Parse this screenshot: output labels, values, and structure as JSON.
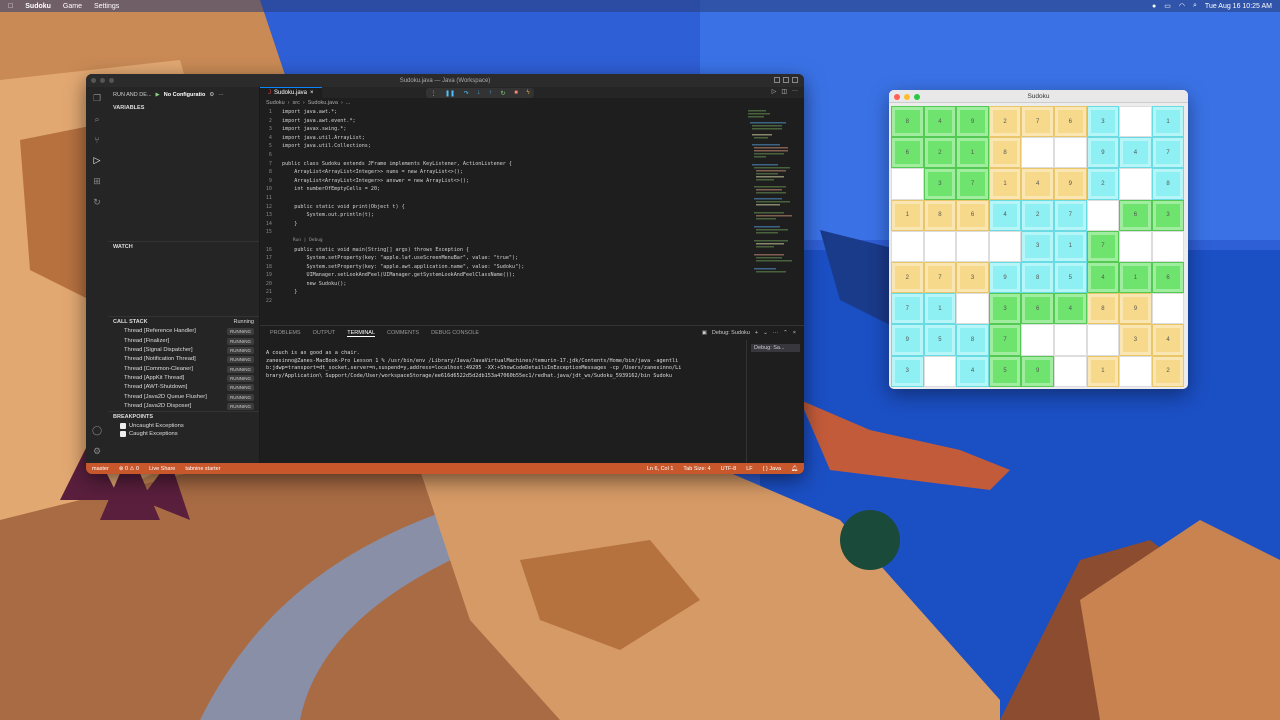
{
  "menubar": {
    "app": "Sudoku",
    "menus": [
      "Game",
      "Settings"
    ],
    "clock": "Tue Aug 16  10:25 AM"
  },
  "vscode": {
    "title": "Sudoku.java — Java (Workspace)",
    "run_label": "RUN AND DE...",
    "config_label": "No Configuratio",
    "sections": {
      "variables": "VARIABLES",
      "watch": "WATCH",
      "call_stack": "CALL STACK",
      "call_stack_status": "Running",
      "breakpoints": "BREAKPOINTS"
    },
    "threads": [
      {
        "name": "Thread [Reference Handler]",
        "status": "RUNNING"
      },
      {
        "name": "Thread [Finalizer]",
        "status": "RUNNING"
      },
      {
        "name": "Thread [Signal Dispatcher]",
        "status": "RUNNING"
      },
      {
        "name": "Thread [Notification Thread]",
        "status": "RUNNING"
      },
      {
        "name": "Thread [Common-Cleaner]",
        "status": "RUNNING"
      },
      {
        "name": "Thread [AppKit Thread]",
        "status": "RUNNING"
      },
      {
        "name": "Thread [AWT-Shutdown]",
        "status": "RUNNING"
      },
      {
        "name": "Thread [Java2D Queue Flusher]",
        "status": "RUNNING"
      },
      {
        "name": "Thread [Java2D Disposer]",
        "status": "RUNNING"
      }
    ],
    "breakpoints": [
      "Uncaught Exceptions",
      "Caught Exceptions"
    ],
    "tab": "Sudoku.java",
    "breadcrumb": [
      "Sudoku",
      "src",
      "Sudoku.java",
      "..."
    ],
    "code": [
      {
        "n": "1",
        "t": "import java.awt.*;"
      },
      {
        "n": "2",
        "t": "import java.awt.event.*;"
      },
      {
        "n": "3",
        "t": "import javax.swing.*;"
      },
      {
        "n": "4",
        "t": "import java.util.ArrayList;"
      },
      {
        "n": "5",
        "t": "import java.util.Collections;"
      },
      {
        "n": "6",
        "t": ""
      },
      {
        "n": "7",
        "t": "public class Sudoku extends JFrame implements KeyListener, ActionListener {"
      },
      {
        "n": "8",
        "t": "    ArrayList<ArrayList<Integer>> nums = new ArrayList<>();"
      },
      {
        "n": "9",
        "t": "    ArrayList<ArrayList<Integer>> answer = new ArrayList<>();"
      },
      {
        "n": "10",
        "t": "    int numberOfEmptyCells = 20;"
      },
      {
        "n": "11",
        "t": ""
      },
      {
        "n": "12",
        "t": "    public static void print(Object t) {"
      },
      {
        "n": "13",
        "t": "        System.out.println(t);"
      },
      {
        "n": "14",
        "t": "    }"
      },
      {
        "n": "15",
        "t": ""
      },
      {
        "n": "",
        "t": "    Run | Debug"
      },
      {
        "n": "16",
        "t": "    public static void main(String[] args) throws Exception {"
      },
      {
        "n": "17",
        "t": "        System.setProperty(key: \"apple.laf.useScreenMenuBar\", value: \"true\");"
      },
      {
        "n": "18",
        "t": "        System.setProperty(key: \"apple.awt.application.name\", value: \"Sudoku\");"
      },
      {
        "n": "19",
        "t": "        UIManager.setLookAndFeel(UIManager.getSystemLookAndFeelClassName());"
      },
      {
        "n": "20",
        "t": "        new Sudoku();"
      },
      {
        "n": "21",
        "t": "    }"
      },
      {
        "n": "22",
        "t": ""
      }
    ],
    "panel_tabs": [
      "PROBLEMS",
      "OUTPUT",
      "TERMINAL",
      "COMMENTS",
      "DEBUG CONSOLE"
    ],
    "panel_active": "TERMINAL",
    "terminal_session": "Debug: Sudoku",
    "terminal_side": "Debug: Sa...",
    "terminal_lines": [
      "A couch is as good as a chair.",
      "zanesinno@Zanes-MacBook-Pro Lesson 1 %  /usr/bin/env /Library/Java/JavaVirtualMachines/temurin-17.jdk/Contents/Home/bin/java -agentli",
      "b:jdwp=transport=dt_socket,server=n,suspend=y,address=localhost:49295 -XX:+ShowCodeDetailsInExceptionMessages -cp /Users/zanesinno/Li",
      "brary/Application\\ Support/Code/User/workspaceStorage/ee616d6522d5d2db153a47060b55ec1/redhat.java/jdt_ws/Sudoku_5939162/bin Sudoku"
    ],
    "status": {
      "branch": "master",
      "problems": "⊗ 0 ⚠ 0",
      "live_share": "Live Share",
      "tabnine": "tabnine starter",
      "position": "Ln 6, Col 1",
      "tab_size": "Tab Size: 4",
      "encoding": "UTF-8",
      "eol": "LF",
      "language": "{ }  Java"
    }
  },
  "sudoku": {
    "title": "Sudoku",
    "colors": {
      "green": "#6ee46e",
      "yellow": "#f6d98a",
      "cyan": "#8ff0f4"
    },
    "rows": [
      [
        "8",
        "4",
        "9",
        "2",
        "7",
        "6",
        "3",
        "",
        "1"
      ],
      [
        "6",
        "2",
        "1",
        "8",
        "",
        "",
        "9",
        "4",
        "7"
      ],
      [
        "",
        "3",
        "7",
        "1",
        "4",
        "9",
        "2",
        "",
        "8"
      ],
      [
        "1",
        "8",
        "6",
        "4",
        "2",
        "7",
        "",
        "6",
        "3"
      ],
      [
        "",
        "",
        "",
        "",
        "3",
        "1",
        "7",
        "",
        ""
      ],
      [
        "2",
        "7",
        "3",
        "9",
        "8",
        "5",
        "4",
        "1",
        "6"
      ],
      [
        "7",
        "1",
        "",
        "3",
        "6",
        "4",
        "8",
        "9",
        ""
      ],
      [
        "9",
        "5",
        "8",
        "7",
        "",
        "",
        "",
        "3",
        "4"
      ],
      [
        "3",
        "",
        "4",
        "5",
        "9",
        "",
        "1",
        "",
        "2"
      ]
    ]
  }
}
